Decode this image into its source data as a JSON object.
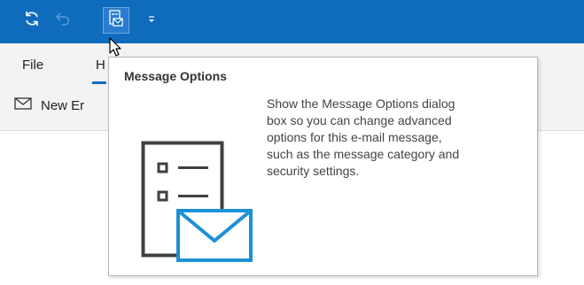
{
  "quick_access_toolbar": {
    "buttons": [
      {
        "icon": "sync-icon"
      },
      {
        "icon": "undo-icon"
      },
      {
        "icon": "message-options-icon"
      },
      {
        "icon": "customize-toolbar-dropdown-icon"
      }
    ]
  },
  "menu": {
    "tabs": [
      {
        "label": "File"
      },
      {
        "label": "H"
      }
    ]
  },
  "ribbon": {
    "new_email_label": "New Er"
  },
  "tooltip": {
    "title": "Message Options",
    "body_lines": [
      "Show the Message Options dialog",
      "box so you can change advanced",
      "options for this e-mail message,",
      "such as the message category and",
      "security settings."
    ]
  },
  "colors": {
    "title_bar": "#0f6cbd",
    "accent": "#0f6cbd",
    "envelope": "#1e90d6",
    "illustration_dark": "#404040"
  }
}
